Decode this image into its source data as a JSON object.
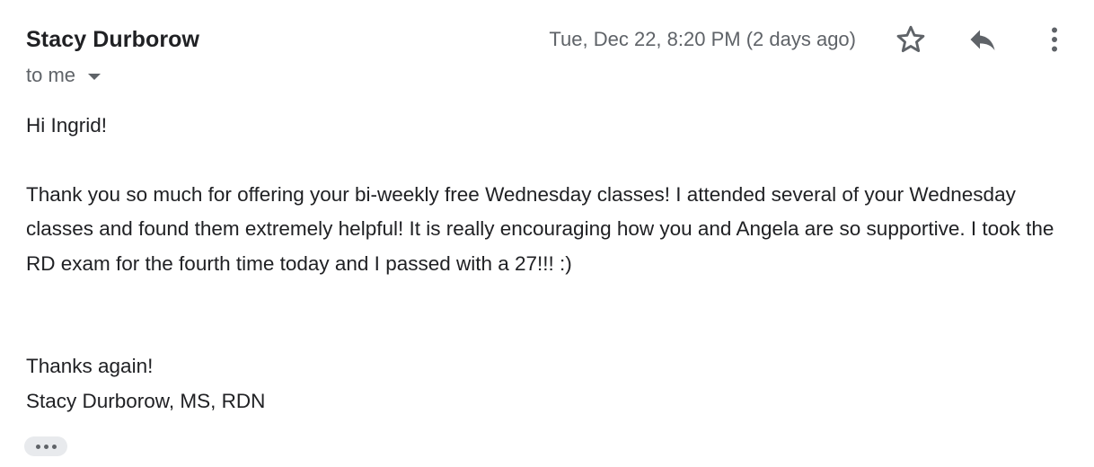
{
  "email": {
    "sender_name": "Stacy Durborow",
    "recipient_label": "to me",
    "date": "Tue, Dec 22, 8:20 PM (2 days ago)",
    "greeting": "Hi Ingrid!",
    "body_paragraph": "Thank you so much for offering your bi-weekly free Wednesday classes! I attended several of your Wednesday classes and found them extremely helpful! It is really encouraging how you and Angela are so supportive. I took the RD exam for the fourth time today and I passed with a 27!!! :)",
    "closing": "Thanks again!",
    "signature": "Stacy Durborow, MS, RDN"
  },
  "icons": {
    "star": "star-icon",
    "reply": "reply-icon",
    "more": "more-vert-icon",
    "caret": "chevron-down-icon",
    "trimmed": "ellipsis-icon"
  },
  "colors": {
    "text_primary": "#202124",
    "text_secondary": "#5f6368",
    "chip_bg": "#e8eaed"
  }
}
